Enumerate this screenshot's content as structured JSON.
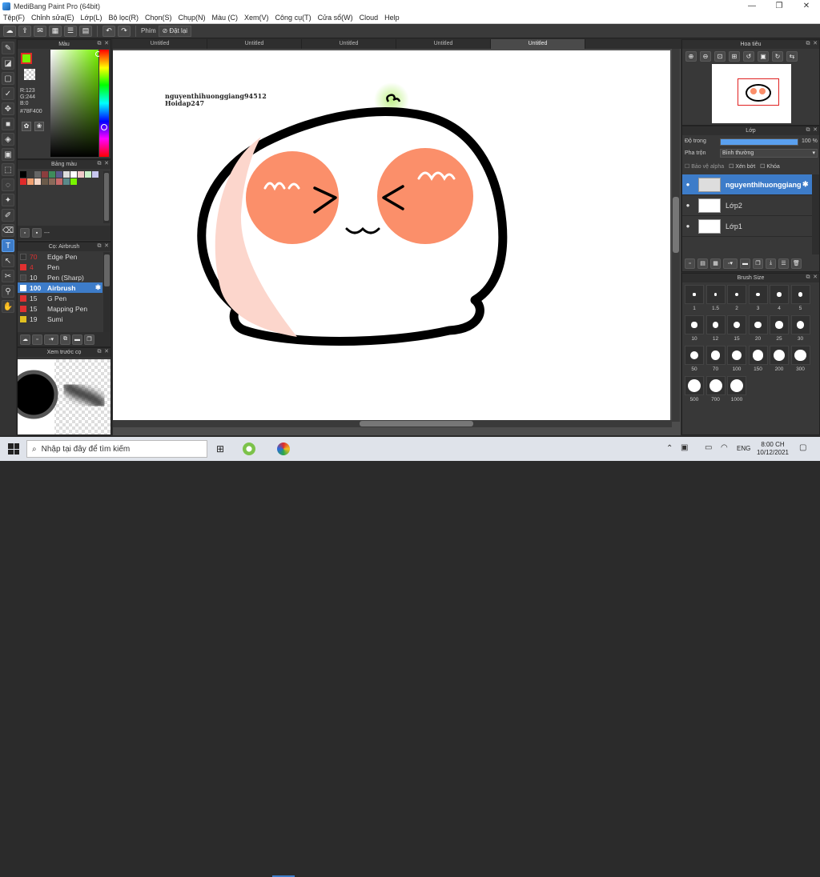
{
  "window": {
    "title": "MediBang Paint Pro (64bit)",
    "minimize": "—",
    "maximize": "❐",
    "close": "✕"
  },
  "menu": [
    "Tệp(F)",
    "Chỉnh sửa(E)",
    "Lớp(L)",
    "Bộ lọc(R)",
    "Chọn(S)",
    "Chụp(N)",
    "Màu (C)",
    "Xem(V)",
    "Công cụ(T)",
    "Cửa sổ(W)",
    "Cloud",
    "Help"
  ],
  "toolbar": {
    "hotkey_label": "Phím",
    "reset_label": "Đặt lại"
  },
  "color_panel": {
    "title": "Màu",
    "r": "R:123",
    "g": "G:244",
    "b": "B:0",
    "hex": "#78F400",
    "current_color": "#78f400"
  },
  "palette_panel": {
    "title": "Bảng màu",
    "name": "---",
    "swatches": [
      "#000000",
      "#3a3a3a",
      "#666666",
      "#8c3e3e",
      "#3e8c5a",
      "#5a5a8c",
      "#dddddd",
      "#ffffff",
      "#f0c8c8",
      "#c8f0c8",
      "#c8c8f0",
      "#e02a2a",
      "#f0a070",
      "#f5d6c6",
      "#6a5a4a",
      "#8a6a5a",
      "#c86a6a",
      "#5a8a8a",
      "#78f400"
    ]
  },
  "brush_panel": {
    "title": "Cọ: Airbrush",
    "items": [
      {
        "size": "70",
        "name": "Edge Pen",
        "color": "#333333"
      },
      {
        "size": "4",
        "name": "Pen",
        "color": "#e03030"
      },
      {
        "size": "10",
        "name": "Pen (Sharp)",
        "color": "#444444"
      },
      {
        "size": "100",
        "name": "Airbrush",
        "color": "#ffffff"
      },
      {
        "size": "15",
        "name": "G Pen",
        "color": "#e03030"
      },
      {
        "size": "15",
        "name": "Mapping Pen",
        "color": "#e03030"
      },
      {
        "size": "19",
        "name": "Sumi",
        "color": "#e0c020"
      }
    ]
  },
  "preview_panel": {
    "title": "Xem trước cọ"
  },
  "tabs": [
    "Untitled",
    "Untitled",
    "Untitled",
    "Untitled",
    "Untitled"
  ],
  "canvas": {
    "watermark_line1": "nguyenthihuonggiang94512",
    "watermark_line2": "Hoidap247"
  },
  "navigator": {
    "title": "Hoa tiêu"
  },
  "layers": {
    "title": "Lớp",
    "opacity_label": "Độ trong",
    "opacity_value": "100 %",
    "opacity_fraction": 1.0,
    "blend_label": "Pha trộn",
    "blend_value": "Bình thường",
    "protect_alpha": "Bảo vệ alpha",
    "clipping": "Xén bớt",
    "lock": "Khóa",
    "items": [
      {
        "name": "nguyenthihuonggiang",
        "selected": true
      },
      {
        "name": "Lớp2",
        "selected": false
      },
      {
        "name": "Lớp1",
        "selected": false
      }
    ]
  },
  "brush_size": {
    "title": "Brush Size",
    "sizes": [
      "1",
      "1.5",
      "2",
      "3",
      "4",
      "5",
      "10",
      "12",
      "15",
      "20",
      "25",
      "30",
      "50",
      "70",
      "100",
      "150",
      "200",
      "300",
      "500",
      "700",
      "1000"
    ]
  },
  "taskbar": {
    "search_placeholder": "Nhập tại đây để tìm kiếm",
    "lang": "ENG",
    "time": "8:00 CH",
    "date": "10/12/2021"
  }
}
